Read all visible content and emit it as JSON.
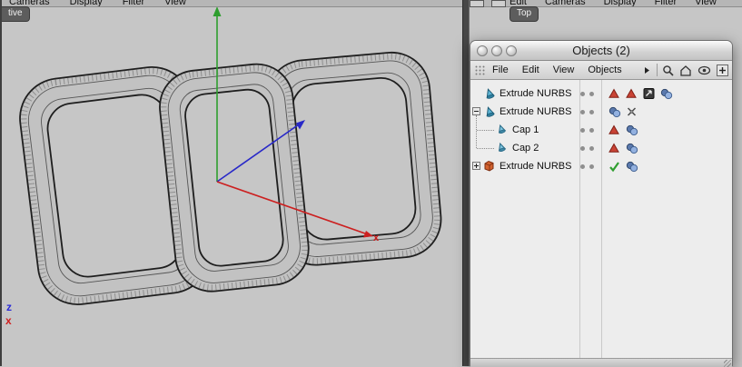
{
  "left_viewport": {
    "label": "tive",
    "menu_items": [
      "Cameras",
      "Display",
      "Filter",
      "View"
    ],
    "axis": {
      "z_label": "z",
      "x_label": "x"
    }
  },
  "right_viewport": {
    "label": "Top",
    "menu_items": [
      "Edit",
      "Cameras",
      "Display",
      "Filter",
      "View"
    ]
  },
  "palette": {
    "title": "Objects (2)",
    "menu_items": [
      "File",
      "Edit",
      "View",
      "Objects"
    ],
    "toolbar_icons": [
      "search-icon",
      "home-icon",
      "eye-icon",
      "add-icon"
    ],
    "rows": [
      {
        "label": "Extrude NURBS",
        "icon": "extrude-blue",
        "indent": 0,
        "expander": "none",
        "dots": 2,
        "tags": [
          "red-tri",
          "red-tri",
          "arrow-tag",
          "phong"
        ]
      },
      {
        "label": "Extrude NURBS",
        "icon": "extrude-blue",
        "indent": 0,
        "expander": "minus",
        "dots": 2,
        "tags": [
          "phong",
          "cross-tag"
        ]
      },
      {
        "label": "Cap 1",
        "icon": "cap-blue",
        "indent": 1,
        "expander": "none",
        "dots": 2,
        "tags": [
          "red-tri",
          "phong"
        ]
      },
      {
        "label": "Cap 2",
        "icon": "cap-blue",
        "indent": 1,
        "expander": "none",
        "dots": 2,
        "tags": [
          "red-tri",
          "phong"
        ]
      },
      {
        "label": "Extrude NURBS",
        "icon": "extrude-red",
        "indent": 0,
        "expander": "plus",
        "dots": 2,
        "tags": [
          "green-check",
          "phong"
        ]
      }
    ]
  },
  "colors": {
    "axis_x": "#cc2020",
    "axis_y": "#2e9e2e",
    "axis_z": "#2828c8",
    "warning_red": "#c94335",
    "check_green": "#2f9e2f"
  }
}
